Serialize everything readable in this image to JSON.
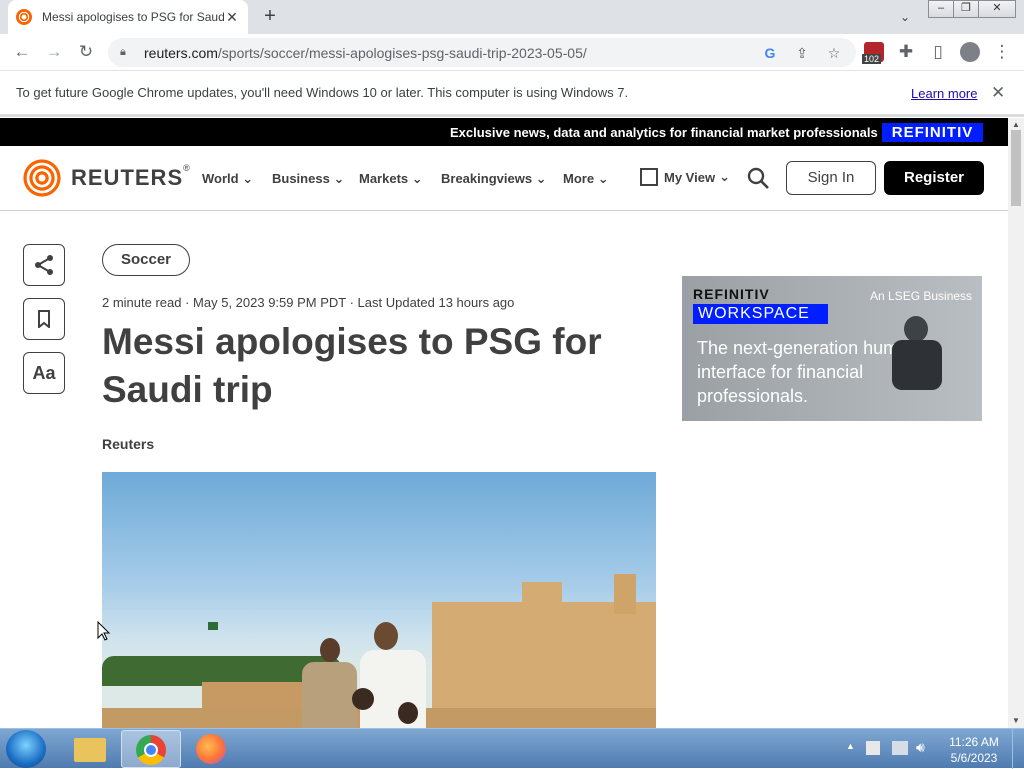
{
  "browser": {
    "tab_title": "Messi apologises to PSG for Saudi trip",
    "new_tab_glyph": "+",
    "url_host": "reuters.com",
    "url_path": "/sports/soccer/messi-apologises-psg-saudi-trip-2023-05-05/",
    "extension_badge": "102",
    "infobar_text": "To get future Google Chrome updates, you'll need Windows 10 or later. This computer is using Windows 7.",
    "infobar_link": "Learn more"
  },
  "promo": {
    "text": "Exclusive news, data and analytics for financial market professionals",
    "badge": "REFINITIV"
  },
  "site_nav": {
    "logo_text": "REUTERS",
    "items": [
      "World",
      "Business",
      "Markets",
      "Breakingviews",
      "More"
    ],
    "my_view": "My View",
    "sign_in": "Sign In",
    "register": "Register"
  },
  "side_tools": {
    "text_size": "Aa"
  },
  "article": {
    "section_tag": "Soccer",
    "meta": "2 minute read · May 5, 2023 9:59 PM PDT · Last Updated 13 hours ago",
    "headline": "Messi apologises to PSG for Saudi trip",
    "byline": "Reuters"
  },
  "ad": {
    "brand": "REFINITIV",
    "product": "WORKSPACE",
    "tagline": "An LSEG Business",
    "copy": "The next-generation human interface for financial professionals."
  },
  "taskbar": {
    "time": "11:26 AM",
    "date": "5/6/2023"
  },
  "colors": {
    "reuters_orange": "#fa6400",
    "refinitiv_blue": "#001eff",
    "text_dark": "#404040"
  }
}
